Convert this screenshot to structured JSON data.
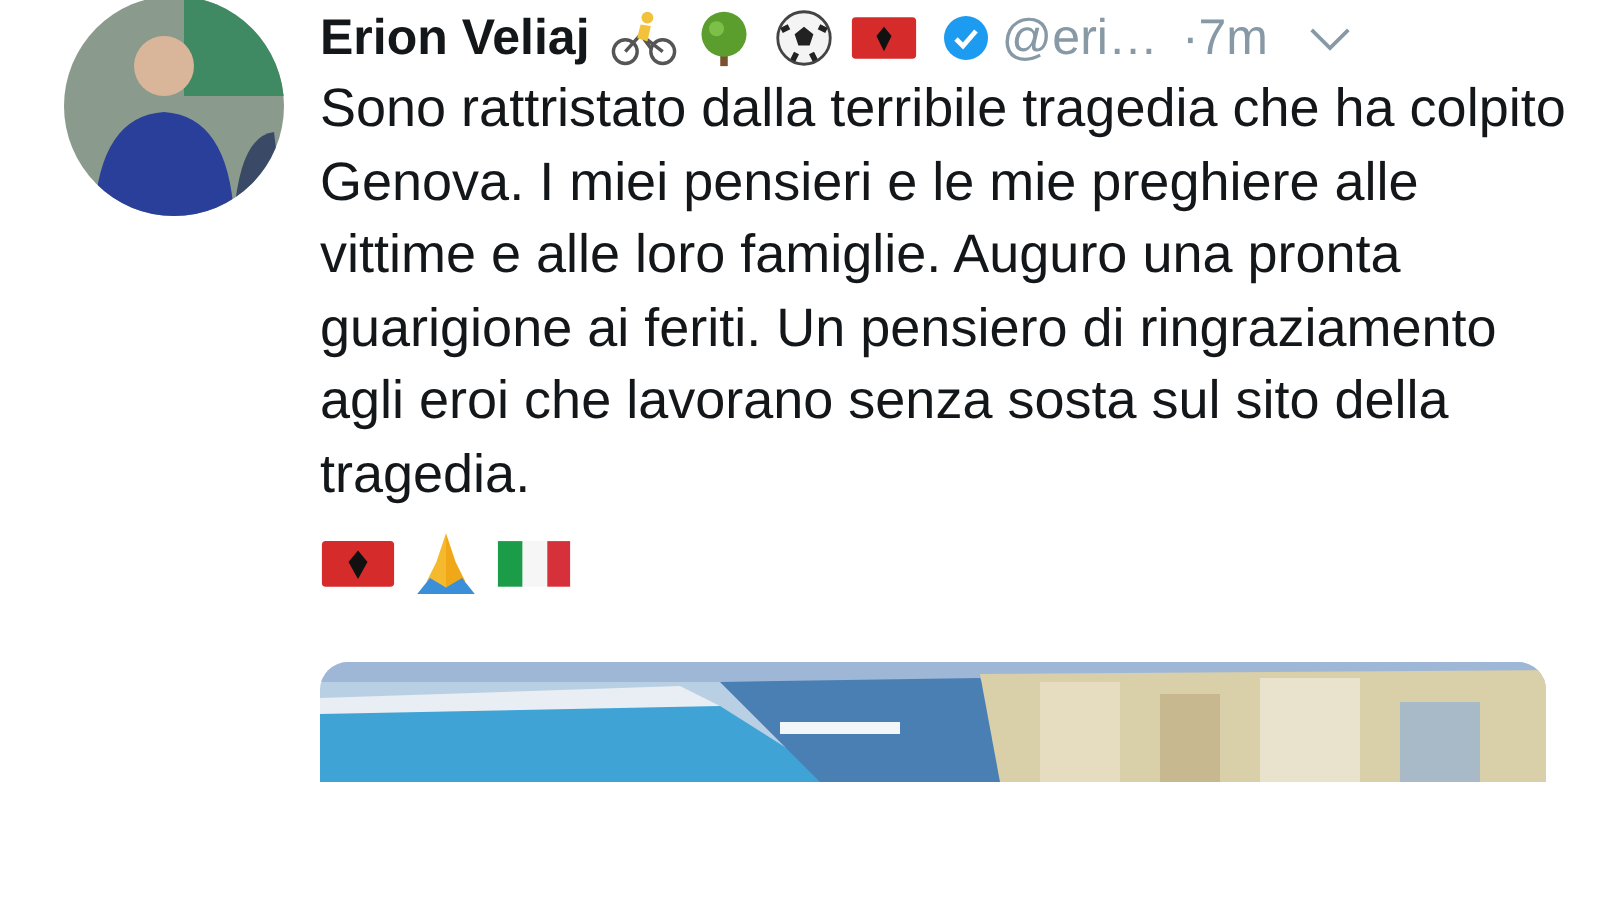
{
  "tweet": {
    "name": "Erion Veliaj",
    "handle": "@eri…",
    "time": "·7m",
    "text": "Sono rattristato dalla terribile tragedia che ha colpito Genova. I miei pensieri e le mie preghiere alle vittime e alle loro famiglie. Auguro una pronta guarigione ai feriti. Un pensiero di ringraziamento agli eroi che lavorano senza sosta sul sito della tragedia.",
    "verified": true
  }
}
